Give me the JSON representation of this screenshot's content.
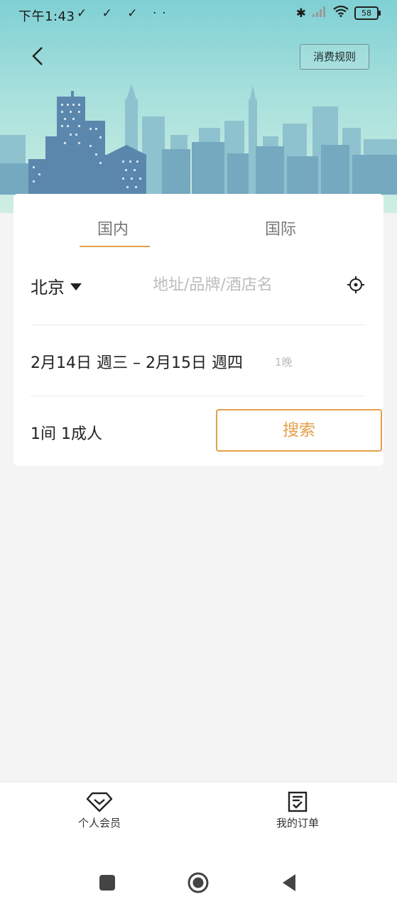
{
  "status_bar": {
    "time": "下午1:43",
    "left_icons": "✓ ✓ ✓ ··",
    "battery": "58"
  },
  "header": {
    "rules_button": "消费规则"
  },
  "search_card": {
    "tabs": [
      {
        "label": "国内",
        "active": true
      },
      {
        "label": "国际",
        "active": false
      }
    ],
    "city": "北京",
    "search_placeholder": "地址/品牌/酒店名",
    "dates": "2月14日 週三 – 2月15日 週四",
    "nights": "1晚",
    "guests": "1间 1成人",
    "search_button": "搜索"
  },
  "bottom_nav": {
    "items": [
      {
        "label": "个人会员",
        "icon": "diamond-icon"
      },
      {
        "label": "我的订单",
        "icon": "order-icon"
      }
    ]
  },
  "colors": {
    "accent": "#e3a04b",
    "hero_top": "#7fd0d4",
    "hero_bottom": "#cfeee3",
    "background": "#f4f4f4"
  }
}
